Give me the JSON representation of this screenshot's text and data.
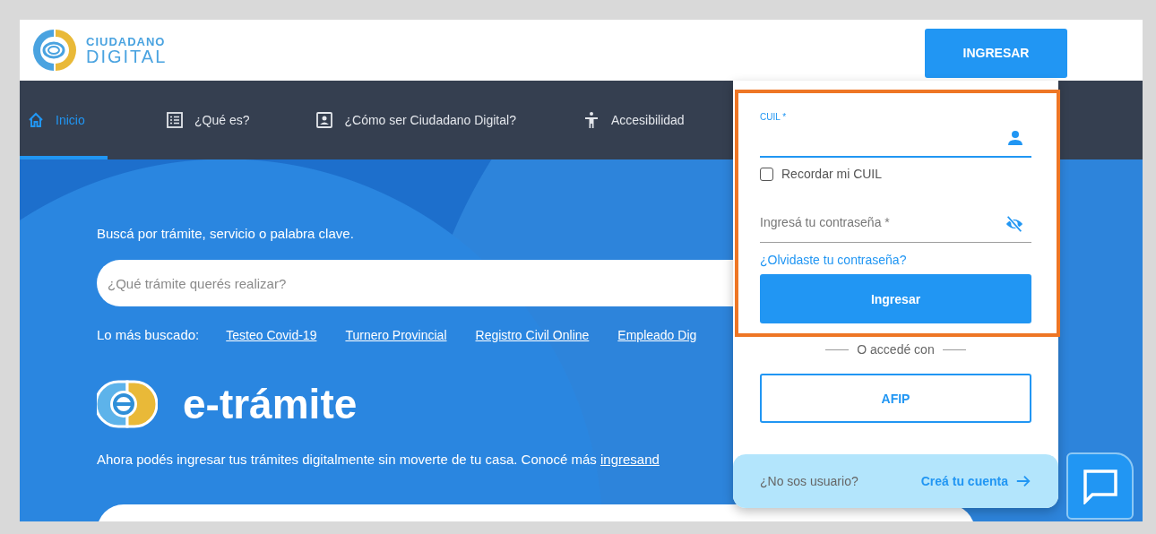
{
  "header": {
    "logo": {
      "line1": "CIUDADANO",
      "line2": "DIGITAL"
    },
    "login_button": "INGRESAR"
  },
  "nav": [
    {
      "label": "Inicio",
      "kind": "home",
      "selected": true
    },
    {
      "label": "¿Qué es?",
      "kind": "list",
      "selected": false
    },
    {
      "label": "¿Cómo ser Ciudadano Digital?",
      "kind": "badge",
      "selected": false
    },
    {
      "label": "Accesibilidad",
      "kind": "person",
      "selected": false
    }
  ],
  "hero": {
    "prompt": "Buscá por trámite, servicio o palabra clave.",
    "search": {
      "placeholder": "¿Qué trámite querés realizar?"
    },
    "popular_label": "Lo más buscado:",
    "popular_links": [
      "Testeo Covid-19",
      "Turnero Provincial",
      "Registro Civil Online",
      "Empleado Dig"
    ],
    "brand": "e-trámite",
    "description": "Ahora podés ingresar tus trámites digitalmente sin moverte de tu casa. Conocé más",
    "description_link": "ingresand"
  },
  "login": {
    "cuil": {
      "label": "CUIL *",
      "focused": true
    },
    "remember": {
      "label": "Recordar mi CUIL",
      "checked": false
    },
    "password": {
      "placeholder": "Ingresá tu contraseña *"
    },
    "forgot": "¿Olvidaste tu contraseña?",
    "submit": "Ingresar",
    "alt_label": "O accedé con",
    "afip": "AFIP",
    "signup_prompt": "¿No sos usuario?",
    "signup_link": "Creá tu cuenta"
  }
}
